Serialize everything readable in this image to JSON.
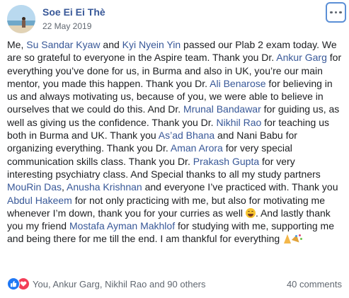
{
  "author": {
    "name": "Soe Ei Ei Thè",
    "date": "22 May 2019"
  },
  "more_button_icon": "ellipsis-icon",
  "colors": {
    "link": "#385898",
    "text": "#1c1e21",
    "secondary": "#606770",
    "like": "#2078f4",
    "love": "#f33e58"
  },
  "post": {
    "segments": [
      {
        "t": "Me, "
      },
      {
        "t": "Su Sandar Kyaw",
        "link": true
      },
      {
        "t": " and "
      },
      {
        "t": "Kyi Nyein Yin",
        "link": true
      },
      {
        "t": " passed our Plab 2 exam today. We are so grateful to everyone in the Aspire team. Thank you Dr. "
      },
      {
        "t": "Ankur Garg",
        "link": true
      },
      {
        "t": " for everything you’ve done for us, in Burma and also in UK, you’re our main mentor, you made this happen. Thank you Dr. "
      },
      {
        "t": "Ali Benarose",
        "link": true
      },
      {
        "t": " for believing in us and always motivating us, because of you, we were able to believe in ourselves that we could do this. And Dr. "
      },
      {
        "t": "Mrunal Bandawar",
        "link": true
      },
      {
        "t": " for guiding us, as well as giving us the confidence. Thank you Dr. "
      },
      {
        "t": "Nikhil Rao",
        "link": true
      },
      {
        "t": " for teaching us both in Burma and UK. Thank you "
      },
      {
        "t": "As’ad Bhana",
        "link": true
      },
      {
        "t": " and Nani Babu for organizing everything. Thank you Dr. "
      },
      {
        "t": "Aman Arora",
        "link": true
      },
      {
        "t": " for very special communication skills class. Thank you Dr. "
      },
      {
        "t": "Prakash Gupta",
        "link": true
      },
      {
        "t": " for very interesting psychiatry class. And Special thanks to all my study partners "
      },
      {
        "t": "MouRin Das",
        "link": true
      },
      {
        "t": ", "
      },
      {
        "t": "Anusha Krishnan",
        "link": true
      },
      {
        "t": " and everyone I’ve practiced with. Thank you "
      },
      {
        "t": "Abdul Hakeem",
        "link": true
      },
      {
        "t": " for not only practicing with me, but also for motivating me whenever I’m down, thank you for your curries as well "
      },
      {
        "emoji": "laughing-emoji"
      },
      {
        "t": ". And lastly thank you my friend "
      },
      {
        "t": "Mostafa Ayman Makhlof",
        "link": true
      },
      {
        "t": " for studying with me, supporting me and being there for me till the end. I am thankful for everything "
      },
      {
        "emoji": "pray-emoji"
      },
      {
        "emoji": "party-popper-emoji"
      }
    ]
  },
  "footer": {
    "reaction_icons": [
      "like-icon",
      "love-icon"
    ],
    "reactions_text": "You, Ankur Garg, Nikhil Rao and 90 others",
    "comments_text": "40 comments"
  }
}
